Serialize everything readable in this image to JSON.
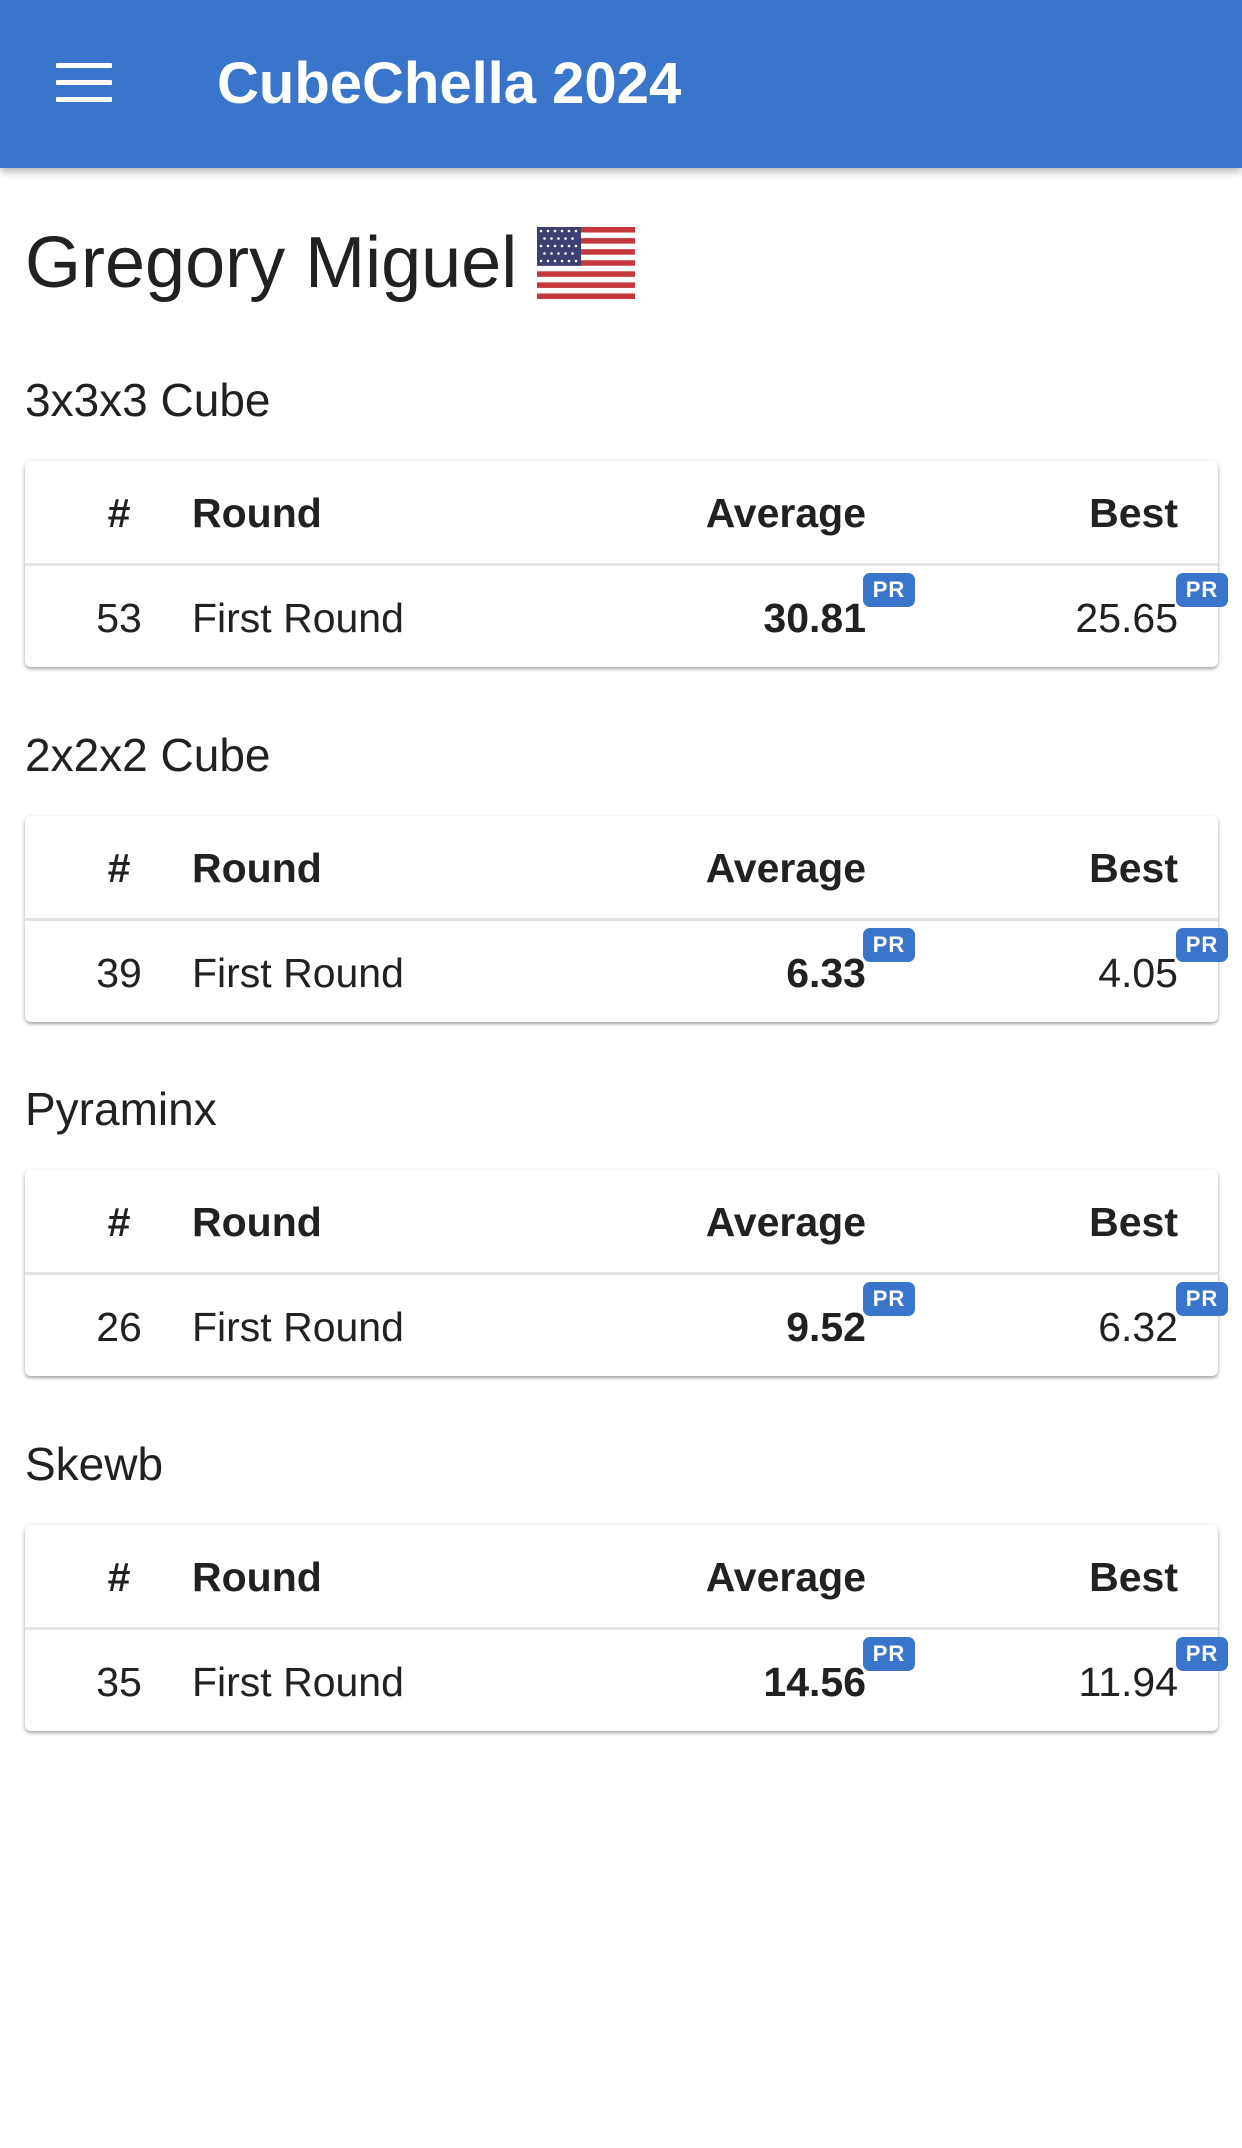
{
  "app": {
    "title": "CubeChella 2024",
    "menu_icon": "hamburger-menu-icon",
    "accent_color": "#3a75cc"
  },
  "person": {
    "name": "Gregory Miguel",
    "flag_icon": "us-flag-icon"
  },
  "table_headers": {
    "rank": "#",
    "round": "Round",
    "average": "Average",
    "best": "Best"
  },
  "events": [
    {
      "name": "3x3x3 Cube",
      "results": [
        {
          "rank": "53",
          "round": "First Round",
          "average": "30.81",
          "average_badge": "PR",
          "best": "25.65",
          "best_badge": "PR"
        }
      ]
    },
    {
      "name": "2x2x2 Cube",
      "results": [
        {
          "rank": "39",
          "round": "First Round",
          "average": "6.33",
          "average_badge": "PR",
          "best": "4.05",
          "best_badge": "PR"
        }
      ]
    },
    {
      "name": "Pyraminx",
      "results": [
        {
          "rank": "26",
          "round": "First Round",
          "average": "9.52",
          "average_badge": "PR",
          "best": "6.32",
          "best_badge": "PR"
        }
      ]
    },
    {
      "name": "Skewb",
      "results": [
        {
          "rank": "35",
          "round": "First Round",
          "average": "14.56",
          "average_badge": "PR",
          "best": "11.94",
          "best_badge": "PR"
        }
      ]
    }
  ]
}
